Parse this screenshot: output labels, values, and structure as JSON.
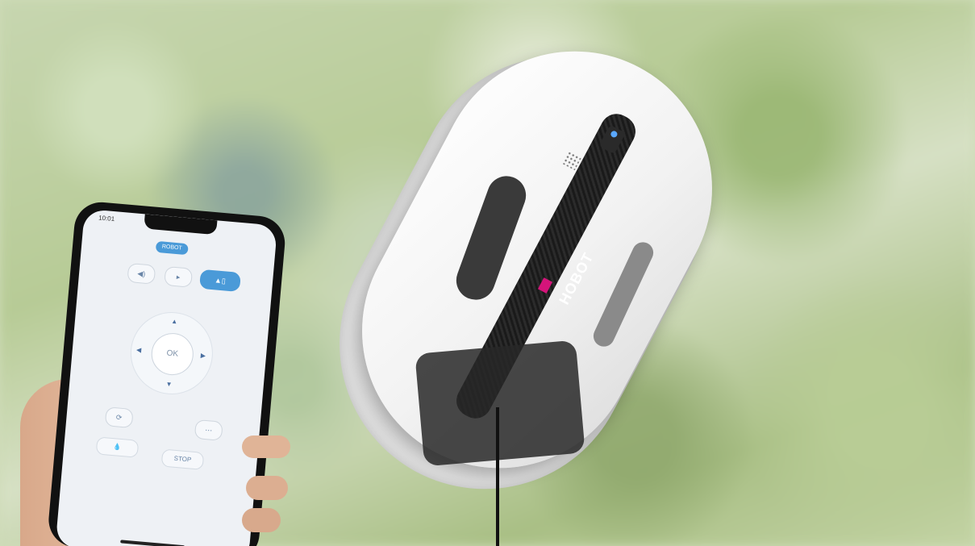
{
  "phone_app": {
    "status_time": "10:01",
    "robot_label": "ROBOT",
    "ok_label": "OK",
    "stop_label": "STOP"
  },
  "robot": {
    "brand": "HOBOT"
  },
  "colors": {
    "app_accent": "#4a9ad8",
    "brand_tag": "#d4147a"
  },
  "icons": [
    "volume-icon",
    "play-icon",
    "mode-icon",
    "arrow-up-icon",
    "arrow-down-icon",
    "arrow-left-icon",
    "arrow-right-icon",
    "cycle-icon",
    "water-drop-icon",
    "settings-icon"
  ]
}
